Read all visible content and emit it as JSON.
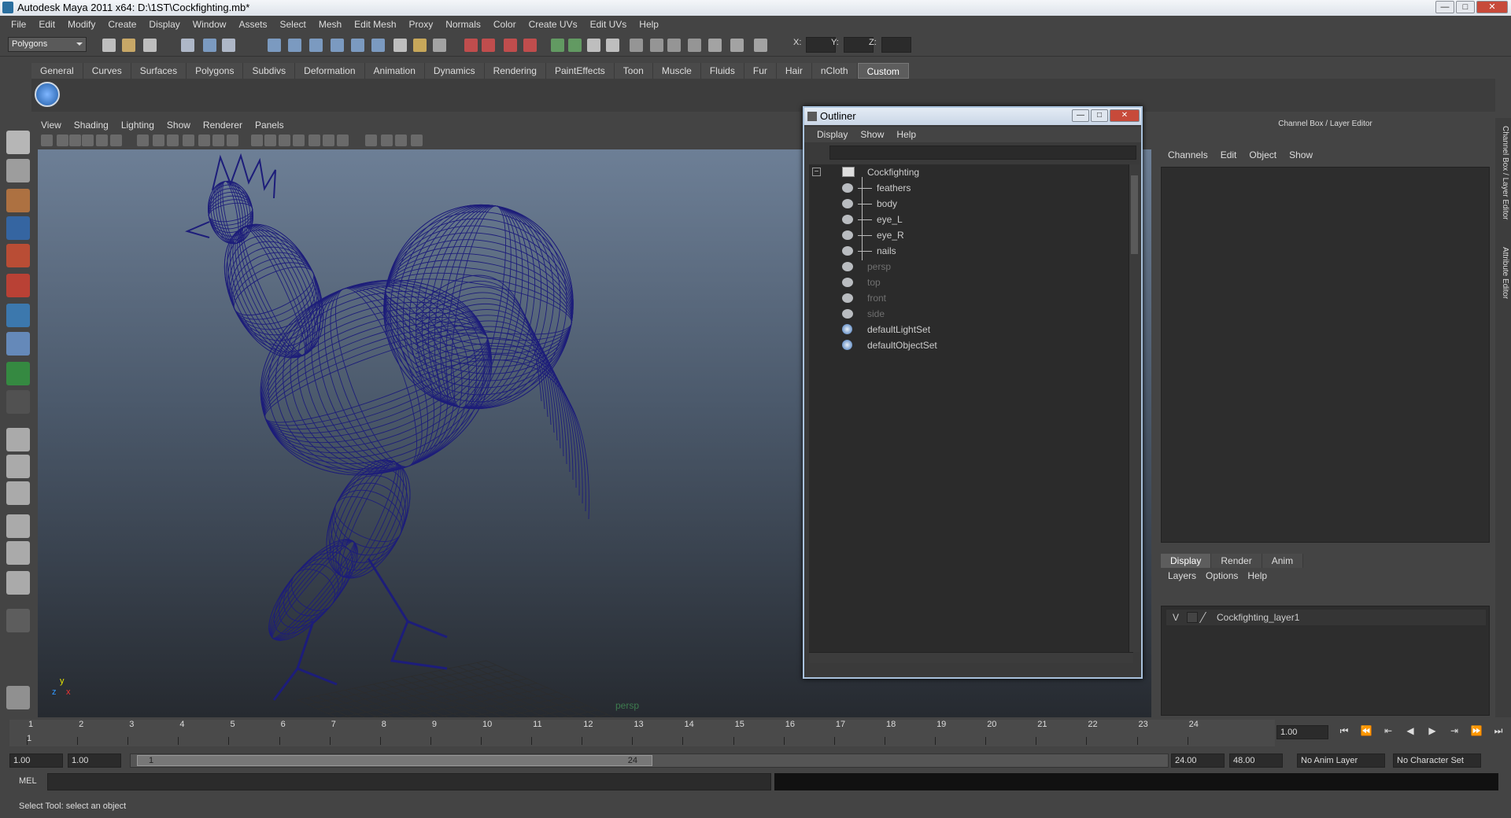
{
  "window": {
    "title": "Autodesk Maya 2011 x64: D:\\1ST\\Cockfighting.mb*",
    "min": "—",
    "max": "□",
    "close": "✕"
  },
  "menubar": [
    "File",
    "Edit",
    "Modify",
    "Create",
    "Display",
    "Window",
    "Assets",
    "Select",
    "Mesh",
    "Edit Mesh",
    "Proxy",
    "Normals",
    "Color",
    "Create UVs",
    "Edit UVs",
    "Help"
  ],
  "statusline": {
    "mode": "Polygons",
    "x_label": "X:",
    "y_label": "Y:",
    "z_label": "Z:"
  },
  "shelf": {
    "tabs": [
      "General",
      "Curves",
      "Surfaces",
      "Polygons",
      "Subdivs",
      "Deformation",
      "Animation",
      "Dynamics",
      "Rendering",
      "PaintEffects",
      "Toon",
      "Muscle",
      "Fluids",
      "Fur",
      "Hair",
      "nCloth",
      "Custom"
    ],
    "active": "Custom"
  },
  "viewport": {
    "menu": [
      "View",
      "Shading",
      "Lighting",
      "Show",
      "Renderer",
      "Panels"
    ],
    "camera_label": "persp",
    "axis_x": "x",
    "axis_y": "y",
    "axis_z": "z",
    "wire_color": "#1d1d7a"
  },
  "outliner": {
    "title": "Outliner",
    "menu": [
      "Display",
      "Show",
      "Help"
    ],
    "items": [
      {
        "label": "Cockfighting",
        "icon": "group-icon",
        "indent": 0,
        "dim": false
      },
      {
        "label": "feathers",
        "icon": "mesh-icon",
        "indent": 1,
        "dim": false
      },
      {
        "label": "body",
        "icon": "mesh-icon",
        "indent": 1,
        "dim": false
      },
      {
        "label": "eye_L",
        "icon": "mesh-icon",
        "indent": 1,
        "dim": false
      },
      {
        "label": "eye_R",
        "icon": "mesh-icon",
        "indent": 1,
        "dim": false
      },
      {
        "label": "nails",
        "icon": "mesh-icon",
        "indent": 1,
        "dim": false
      },
      {
        "label": "persp",
        "icon": "camera-icon",
        "indent": 0,
        "dim": true
      },
      {
        "label": "top",
        "icon": "camera-icon",
        "indent": 0,
        "dim": true
      },
      {
        "label": "front",
        "icon": "camera-icon",
        "indent": 0,
        "dim": true
      },
      {
        "label": "side",
        "icon": "camera-icon",
        "indent": 0,
        "dim": true
      },
      {
        "label": "defaultLightSet",
        "icon": "set-icon",
        "indent": 0,
        "dim": false
      },
      {
        "label": "defaultObjectSet",
        "icon": "set-icon",
        "indent": 0,
        "dim": false
      }
    ]
  },
  "channelbox": {
    "title": "Channel Box / Layer Editor",
    "menu": [
      "Channels",
      "Edit",
      "Object",
      "Show"
    ],
    "tabs": [
      "Display",
      "Render",
      "Anim"
    ],
    "active_tab": "Display",
    "layer_menu": [
      "Layers",
      "Options",
      "Help"
    ],
    "layer": {
      "visible": "V",
      "name": "Cockfighting_layer1"
    }
  },
  "side_tabs": [
    "Channel Box / Layer Editor",
    "Attribute Editor"
  ],
  "timeline": {
    "ticks": [
      "1",
      "2",
      "3",
      "4",
      "5",
      "6",
      "7",
      "8",
      "9",
      "10",
      "11",
      "12",
      "13",
      "14",
      "15",
      "16",
      "17",
      "18",
      "19",
      "20",
      "21",
      "22",
      "23",
      "24"
    ],
    "current_frame_label": "1",
    "current_time": "1.00",
    "start": "1.00",
    "start2": "1.00",
    "range_start": "1",
    "range_end": "24",
    "end": "24.00",
    "end2": "48.00",
    "anim_layer": "No Anim Layer",
    "char_set": "No Character Set"
  },
  "playback": [
    "⏮",
    "⏪",
    "⇤",
    "◀",
    "▶",
    "⇥",
    "⏩",
    "⏭"
  ],
  "mel": {
    "label": "MEL"
  },
  "help": "Select Tool: select an object"
}
